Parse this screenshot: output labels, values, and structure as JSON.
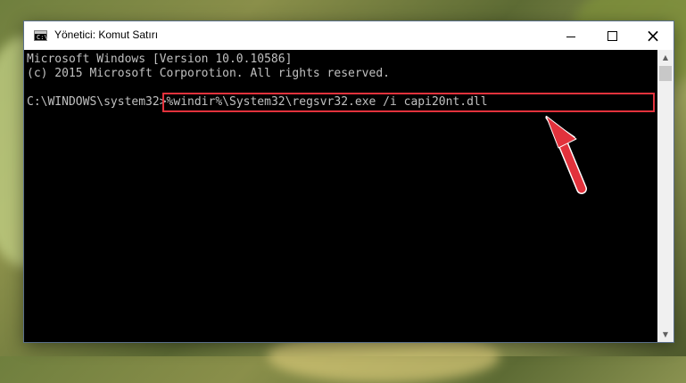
{
  "window": {
    "title": "Yönetici: Komut Satırı",
    "icon": "console-icon",
    "icon_text": "C:\\"
  },
  "controls": {
    "minimize": "minimize-icon",
    "maximize": "maximize-icon",
    "close": "×"
  },
  "console": {
    "lines": [
      "Microsoft Windows [Version 10.0.10586]",
      "(c) 2015 Microsoft Corporotion. All rights reserved."
    ],
    "prompt": "C:\\WINDOWS\\system32>",
    "command": "%windir%\\System32\\regsvr32.exe /i capi20nt.dll"
  },
  "scrollbar": {
    "up": "▲",
    "down": "▼"
  },
  "colors": {
    "highlight_border": "#e2323c",
    "arrow": "#e2323c",
    "console_bg": "#000000",
    "console_text": "#c0c0c0"
  }
}
